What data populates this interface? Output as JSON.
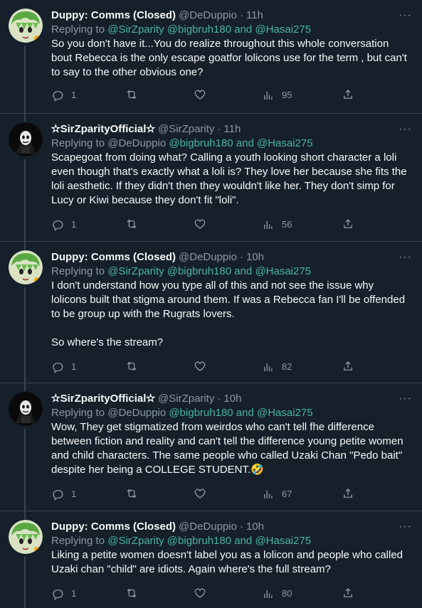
{
  "tweets": [
    {
      "name": "Duppy: Comms (Closed)",
      "handle": "@DeDuppio",
      "time": "11h",
      "replying_prefix": "Replying to ",
      "mentions_plain": "",
      "mentions": "@SirZparity @bigbruh180 and @Hasai275",
      "text": "So you don't have it...You do realize throughout this whole conversation bout Rebecca is the only escape goatfor lolicons use for the term , but can't to say to the other obvious one?",
      "replies": "1",
      "retweets": "",
      "likes": "",
      "views": "95",
      "avatar": "green-hair-avatar"
    },
    {
      "name": "✫SirZparityOfficial✫",
      "handle": "@SirZparity",
      "time": "11h",
      "replying_prefix": "Replying to ",
      "mentions_plain": "@DeDuppio ",
      "mentions": "@bigbruh180 and @Hasai275",
      "text": "Scapegoat from doing what? Calling a youth looking short character a loli even though that's exactly what a loli is? They love her because she fits the loli aesthetic. If they didn't then they wouldn't like her. They don't simp for Lucy or Kiwi because they don't fit \"loli\".",
      "replies": "1",
      "retweets": "",
      "likes": "",
      "views": "56",
      "avatar": "dark-mask-avatar"
    },
    {
      "name": "Duppy: Comms (Closed)",
      "handle": "@DeDuppio",
      "time": "10h",
      "replying_prefix": "Replying to ",
      "mentions_plain": "",
      "mentions": "@SirZparity @bigbruh180 and @Hasai275",
      "text": "I don't understand how you type all of this and not see the issue why lolicons built that stigma around them. If was a Rebecca fan I'll be offended to be group up with the Rugrats lovers.\n\nSo where's the stream?",
      "replies": "1",
      "retweets": "",
      "likes": "",
      "views": "82",
      "avatar": "green-hair-avatar"
    },
    {
      "name": "✫SirZparityOfficial✫",
      "handle": "@SirZparity",
      "time": "10h",
      "replying_prefix": "Replying to ",
      "mentions_plain": "@DeDuppio ",
      "mentions": "@bigbruh180 and @Hasai275",
      "text": "Wow, They get stigmatized from weirdos who can't tell fhe difference between fiction and reality and can't tell the difference young petite women and child characters. The same people who called Uzaki Chan \"Pedo bait\" despite her being a COLLEGE STUDENT.🤣",
      "replies": "1",
      "retweets": "",
      "likes": "",
      "views": "67",
      "avatar": "dark-mask-avatar"
    },
    {
      "name": "Duppy: Comms (Closed)",
      "handle": "@DeDuppio",
      "time": "10h",
      "replying_prefix": "Replying to ",
      "mentions_plain": "",
      "mentions": "@SirZparity @bigbruh180 and @Hasai275",
      "text": "Liking a petite women doesn't label you as a lolicon and people who called Uzaki chan \"child\" are idiots. Again where's the full stream?",
      "replies": "1",
      "retweets": "",
      "likes": "",
      "views": "80",
      "avatar": "green-hair-avatar"
    }
  ],
  "ui": {
    "more": "···",
    "dot": "·"
  }
}
